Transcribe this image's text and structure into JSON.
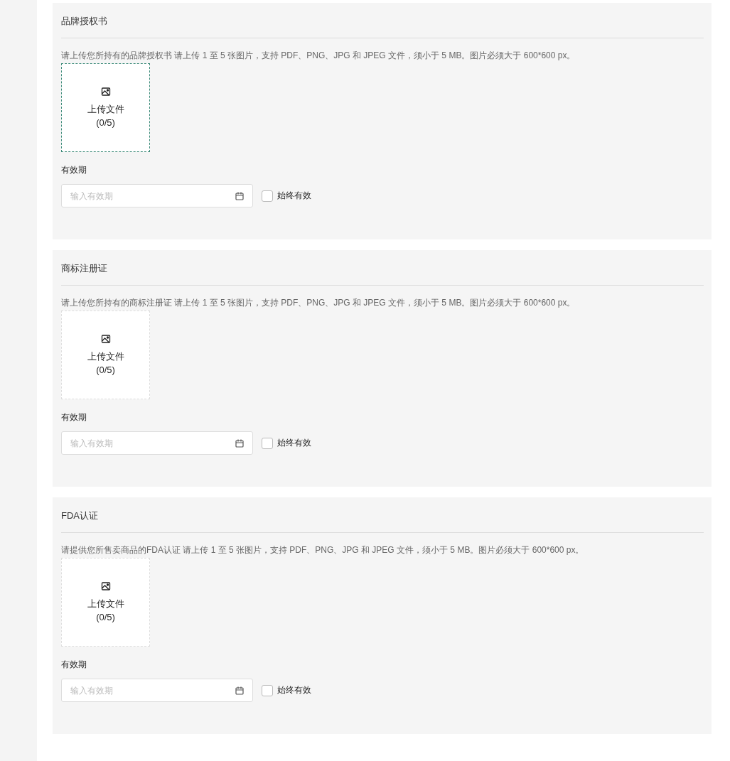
{
  "sections": [
    {
      "title": "品牌授权书",
      "description": "请上传您所持有的品牌授权书 请上传 1 至 5 张图片，支持 PDF、PNG、JPG 和 JPEG 文件，须小于 5 MB。图片必须大于 600*600 px。",
      "upload": {
        "label": "上传文件",
        "count": "(0/5)",
        "focused": true
      },
      "validity": {
        "label": "有效期",
        "placeholder": "输入有效期",
        "always_valid": {
          "label": "始终有效",
          "checked": false
        }
      }
    },
    {
      "title": "商标注册证",
      "description": "请上传您所持有的商标注册证 请上传 1 至 5 张图片，支持 PDF、PNG、JPG 和 JPEG 文件，须小于 5 MB。图片必须大于 600*600 px。",
      "upload": {
        "label": "上传文件",
        "count": "(0/5)",
        "focused": false
      },
      "validity": {
        "label": "有效期",
        "placeholder": "输入有效期",
        "always_valid": {
          "label": "始终有效",
          "checked": false
        }
      }
    },
    {
      "title": "FDA认证",
      "description": "请提供您所售卖商品的FDA认证 请上传 1 至 5 张图片，支持 PDF、PNG、JPG 和 JPEG 文件，须小于 5 MB。图片必须大于 600*600 px。",
      "upload": {
        "label": "上传文件",
        "count": "(0/5)",
        "focused": false
      },
      "validity": {
        "label": "有效期",
        "placeholder": "输入有效期",
        "always_valid": {
          "label": "始终有效",
          "checked": false
        }
      }
    }
  ]
}
